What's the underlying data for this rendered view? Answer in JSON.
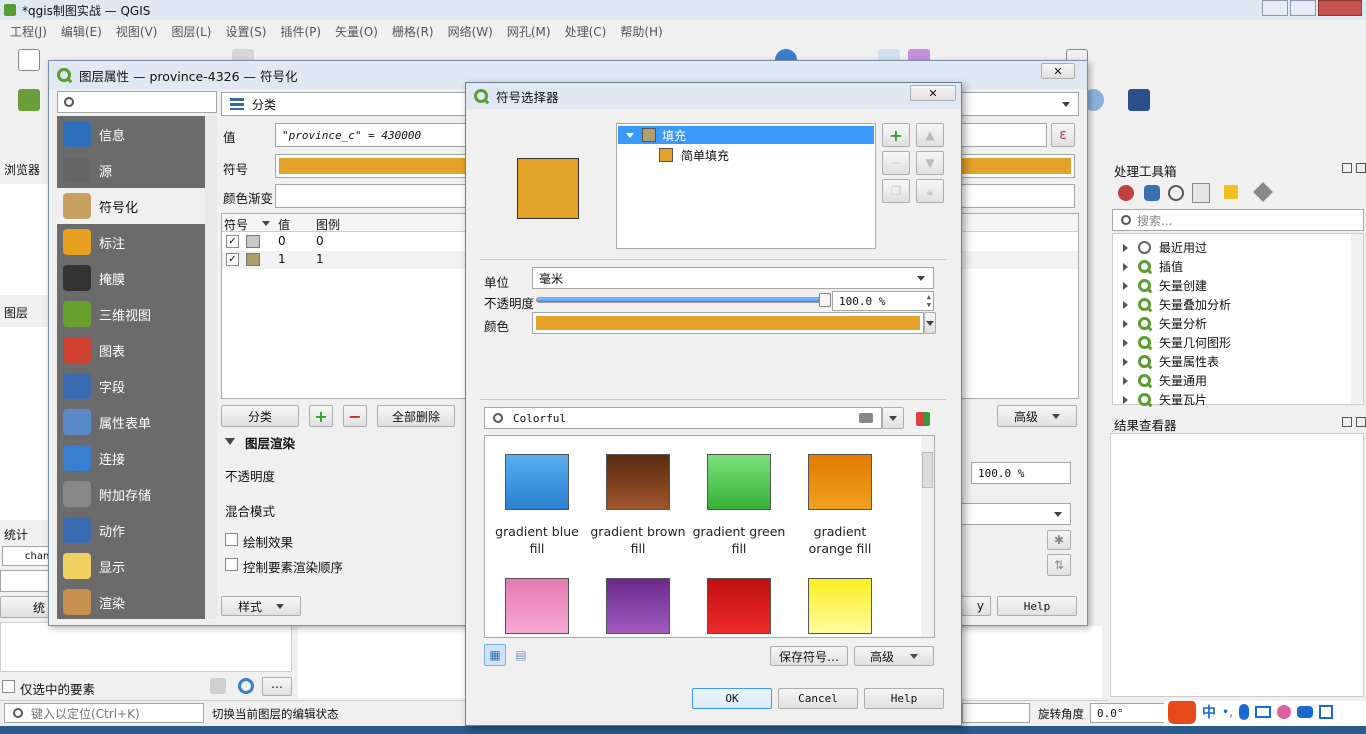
{
  "main_window": {
    "title": "*qgis制图实战 — QGIS",
    "menu": [
      "工程(J)",
      "编辑(E)",
      "视图(V)",
      "图层(L)",
      "设置(S)",
      "插件(P)",
      "矢量(O)",
      "栅格(R)",
      "网络(W)",
      "网孔(M)",
      "处理(C)",
      "帮助(H)"
    ]
  },
  "left_panels": {
    "browser_title": "浏览器",
    "layers_title": "图层",
    "stats_title": "统计",
    "stats_combo": "chan",
    "stats_button": "统",
    "selected_only": "仅选中的要素"
  },
  "status_bar": {
    "locate_placeholder": "键入以定位(Ctrl+K)",
    "message": "切换当前图层的编辑状态",
    "rotation_label": "旋转角度",
    "rotation_value": "0.0°"
  },
  "ime": {
    "lang": "中",
    "punct": "•,"
  },
  "right_panel": {
    "toolbox_title": "处理工具箱",
    "search_placeholder": "搜索...",
    "items": [
      "最近用过",
      "插值",
      "矢量创建",
      "矢量叠加分析",
      "矢量分析",
      "矢量几何图形",
      "矢量属性表",
      "矢量通用",
      "矢量瓦片"
    ],
    "results_title": "结果查看器"
  },
  "layer_props": {
    "title": "图层属性 — province-4326 — 符号化",
    "sidebar": [
      "信息",
      "源",
      "符号化",
      "标注",
      "掩膜",
      "三维视图",
      "图表",
      "字段",
      "属性表单",
      "连接",
      "附加存储",
      "动作",
      "显示",
      "渲染"
    ],
    "active_index": 2,
    "renderer": "分类",
    "value_label": "值",
    "value_expr": "\"province_c\"  =  430000",
    "symbol_label": "符号",
    "ramp_label": "颜色渐变",
    "table_headers": [
      "符号",
      "值",
      "图例"
    ],
    "rows": [
      {
        "value": "0",
        "legend": "0",
        "color": "#c9c9c9"
      },
      {
        "value": "1",
        "legend": "1",
        "color": "#b09f6e"
      }
    ],
    "classify_btn": "分类",
    "delete_all_btn": "全部删除",
    "advanced_btn": "高级",
    "rendering_title": "图层渲染",
    "opacity_label": "不透明度",
    "opacity_value": "100.0 %",
    "blend_label": "混合模式",
    "draw_effects": "绘制效果",
    "control_order": "控制要素渲染顺序",
    "style_btn": "样式",
    "help_btn": "Help",
    "partial_btn": "y"
  },
  "symbol_selector": {
    "title": "符号选择器",
    "fill_color": "#e3a22a",
    "tree": {
      "root": "填充",
      "child": "简单填充"
    },
    "unit_label": "单位",
    "unit_value": "毫米",
    "opacity_label": "不透明度",
    "opacity_value": "100.0 %",
    "opacity_fraction": 1.0,
    "color_label": "颜色",
    "search_value": "Colorful",
    "swatches": [
      {
        "label": "gradient blue fill",
        "color_top": "#5aaef0",
        "color_bottom": "#2a7fd0"
      },
      {
        "label": "gradient brown fill",
        "color_top": "#5a2a10",
        "color_bottom": "#a0552a"
      },
      {
        "label": "gradient green fill",
        "color_top": "#7ee07e",
        "color_bottom": "#36b036"
      },
      {
        "label": "gradient orange fill",
        "color_top": "#e07a00",
        "color_bottom": "#f0a020"
      },
      {
        "label": "",
        "color_top": "#e27ab2",
        "color_bottom": "#f5a8d0"
      },
      {
        "label": "",
        "color_top": "#6a2a8a",
        "color_bottom": "#a05ac0"
      },
      {
        "label": "",
        "color_top": "#c01010",
        "color_bottom": "#ee2a2a"
      },
      {
        "label": "",
        "color_top": "#f8f020",
        "color_bottom": "#fffaa0"
      }
    ],
    "save_btn": "保存符号…",
    "advanced_btn": "高级",
    "ok_btn": "OK",
    "cancel_btn": "Cancel",
    "help_btn": "Help"
  }
}
